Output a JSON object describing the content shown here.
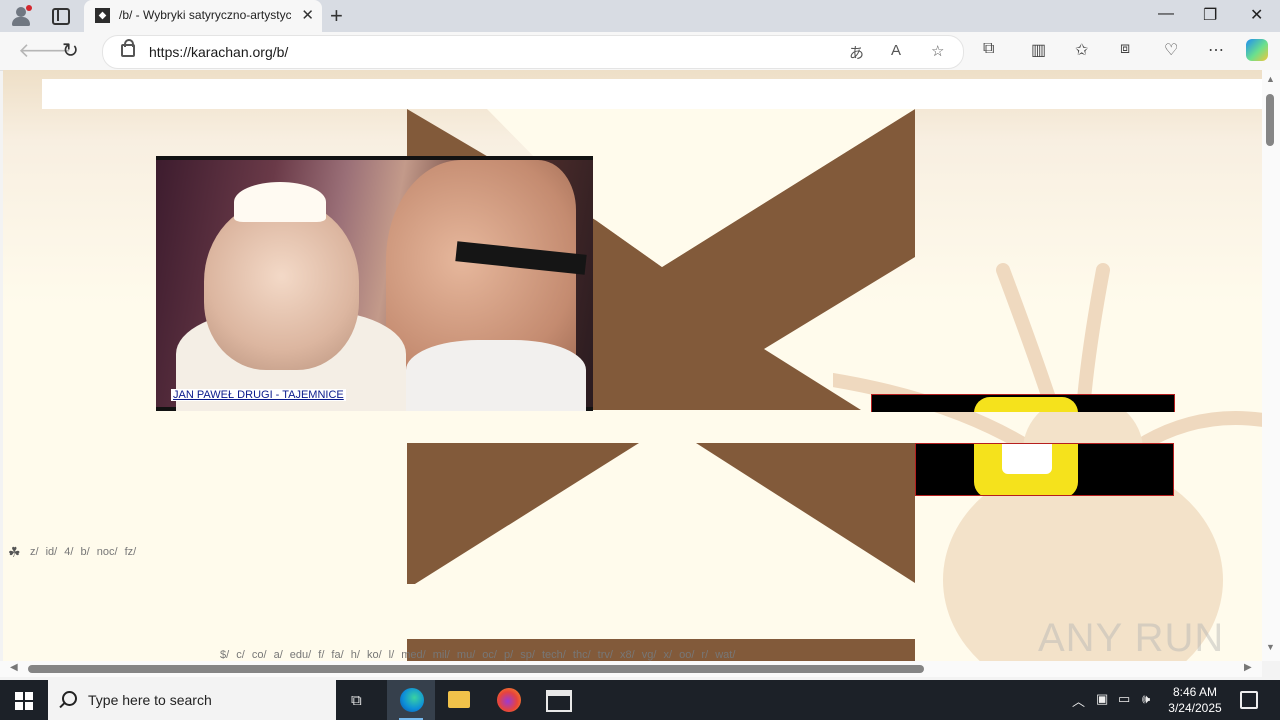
{
  "browser": {
    "tab_title": "/b/ - Wybryki satyryczno-artystyczne",
    "tab_close": "✕",
    "new_tab": "+",
    "url": "https://karachan.org/b/",
    "window_controls": {
      "minimize": "—",
      "restore": "❐",
      "close": "✕"
    }
  },
  "page": {
    "ad_caption": "JAN PAWEŁ DRUGI - TAJEMNICE",
    "nav_top_marker": "☘",
    "nav_top": "z/ id/ 4/ b/ noc/ fz/",
    "nav_bottom": "$/ c/ co/ a/ edu/ f/ fa/ h/ ko/ l/ med/ mil/ mu/ oc/ p/ sp/ tech/ thc/ trv/ x8/ vg/ x/ oo/ r/ wat/",
    "watermark": "ANY RUN",
    "colors": {
      "logo_brown": "#825a3a",
      "background_cream": "#fffbec",
      "top_gradient": "#eedfc7"
    }
  },
  "taskbar": {
    "search_placeholder": "Type here to search",
    "time": "8:46 AM",
    "date": "3/24/2025"
  }
}
